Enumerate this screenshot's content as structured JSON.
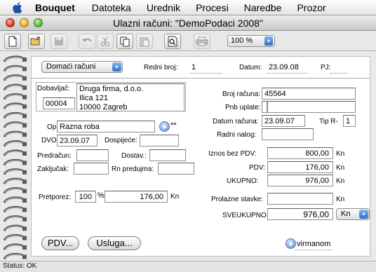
{
  "menubar": {
    "app": "Bouquet",
    "items": [
      "Datoteka",
      "Urednik",
      "Procesi",
      "Naredbe",
      "Prozor"
    ]
  },
  "window": {
    "title": "Ulazni računi: \"DemoPodaci 2008\""
  },
  "toolbar": {
    "zoom": "100 %"
  },
  "header": {
    "type_popup": "Domaći računi",
    "redni_broj_label": "Redni broj:",
    "redni_broj": "1",
    "datum_label": "Datum:",
    "datum": "23.09.08",
    "pj_label": "PJ:"
  },
  "supplier": {
    "label": "Dobavljač:",
    "code": "00004",
    "name": "Druga firma, d.o.o.",
    "street": "Ilica 121",
    "city": "10000 Zagreb"
  },
  "details": {
    "opis_label": "Opis:",
    "opis": "Razna roba",
    "opis_marker": "**",
    "dvo_label": "DVO:",
    "dvo": "23.09.07",
    "dospijece_label": "Dospijeće:",
    "dospijece": "",
    "predracun_label": "Predračun:",
    "predracun": "",
    "dostav_label": "Dostav.:",
    "dostav": "",
    "zakljucak_label": "Zaključak:",
    "zakljucak": "",
    "rn_predujma_label": "Rn predujma:",
    "rn_predujma": "",
    "pretporez_label": "Pretporez:",
    "pretporez_pct": "100",
    "pct_sign": "%",
    "pretporez_amount": "176,00",
    "pretporez_unit": "Kn"
  },
  "invoice": {
    "broj_racuna_label": "Broj računa:",
    "broj_racuna": "45564",
    "pnb_label": "Pnb uplate:",
    "pnb_1": "",
    "pnb_2": "",
    "datum_racuna_label": "Datum računa:",
    "datum_racuna": "23.09.07",
    "tip_label": "Tip R-",
    "tip": "1",
    "radni_nalog_label": "Radni nalog:",
    "radni_nalog": "",
    "iznos_label": "Iznos bez PDV:",
    "iznos": "800,00",
    "pdv_label": "PDV:",
    "pdv": "176,00",
    "ukupno_label": "UKUPNO:",
    "ukupno": "976,00",
    "prolazne_label": "Prolazne stavke:",
    "prolazne": "",
    "sveukupno_label": "SVEUKUPNO:",
    "sveukupno": "976,00",
    "currency_popup": "Kn",
    "unit": "Kn"
  },
  "buttons": {
    "pdv": "PDV...",
    "usluga": "Usluga...",
    "virmanom": "virmanom"
  },
  "status": {
    "text": "Status: OK"
  }
}
